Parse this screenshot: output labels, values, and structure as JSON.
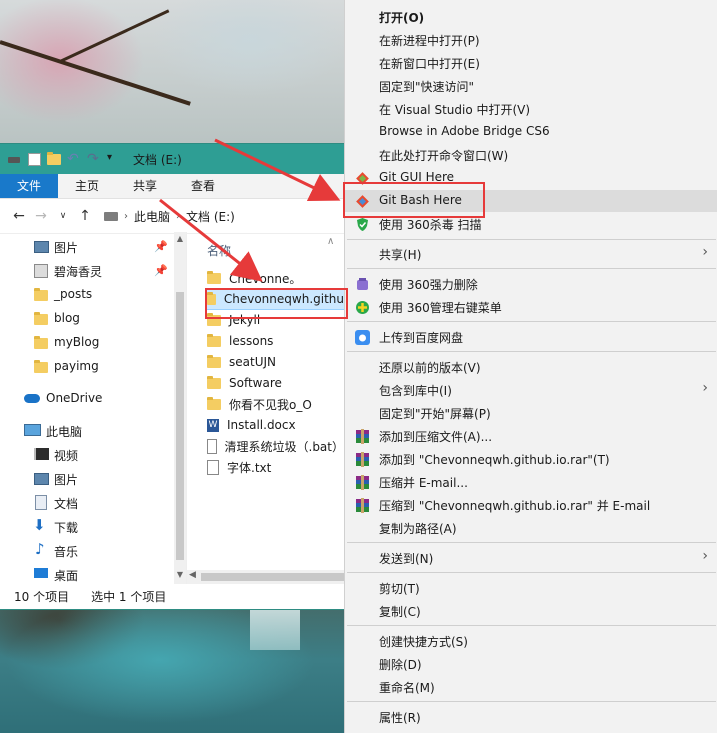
{
  "explorer": {
    "title": "文档 (E:)",
    "ribbon_tabs": [
      "文件",
      "主页",
      "共享",
      "查看"
    ],
    "breadcrumb": [
      "此电脑",
      "文档 (E:)"
    ],
    "column_header": "名称",
    "nav": {
      "quick": [
        {
          "label": "图片",
          "pinned": true
        },
        {
          "label": "碧海香灵",
          "pinned": true
        },
        {
          "label": "_posts",
          "pinned": false
        },
        {
          "label": "blog",
          "pinned": false
        },
        {
          "label": "myBlog",
          "pinned": false
        },
        {
          "label": "payimg",
          "pinned": false
        }
      ],
      "onedrive": "OneDrive",
      "this_pc": "此电脑",
      "pc_items": [
        "视频",
        "图片",
        "文档",
        "下载",
        "音乐",
        "桌面"
      ]
    },
    "files": [
      {
        "name": "Chevonne。",
        "icon": "folder-icon",
        "selected": false
      },
      {
        "name": "Chevonneqwh.githu",
        "icon": "folder-icon",
        "selected": true
      },
      {
        "name": "Jekyll",
        "icon": "folder-icon",
        "selected": false
      },
      {
        "name": "lessons",
        "icon": "folder-icon",
        "selected": false
      },
      {
        "name": "seatUJN",
        "icon": "folder-icon",
        "selected": false
      },
      {
        "name": "Software",
        "icon": "folder-icon",
        "selected": false
      },
      {
        "name": "你看不见我o_O",
        "icon": "folder-icon",
        "selected": false
      },
      {
        "name": "Install.docx",
        "icon": "word-doc-icon",
        "selected": false
      },
      {
        "name": "清理系统垃圾（.bat）",
        "icon": "text-file-icon",
        "selected": false
      },
      {
        "name": "字体.txt",
        "icon": "text-file-icon",
        "selected": false
      }
    ],
    "status": {
      "count": "10 个项目",
      "selected": "选中 1 个项目"
    }
  },
  "menu": {
    "items": [
      {
        "label": "打开(O)",
        "bold": true
      },
      {
        "label": "在新进程中打开(P)"
      },
      {
        "label": "在新窗口中打开(E)"
      },
      {
        "label": "固定到\"快速访问\""
      },
      {
        "label": "在 Visual Studio 中打开(V)"
      },
      {
        "label": "Browse in Adobe Bridge CS6"
      },
      {
        "label": "在此处打开命令窗口(W)"
      },
      {
        "label": "Git GUI Here",
        "icon": "git-icon"
      },
      {
        "label": "Git Bash Here",
        "icon": "git-icon",
        "highlighted": true
      },
      {
        "label": "使用 360杀毒 扫描",
        "icon": "shield-icon"
      },
      {
        "label": "共享(H)",
        "submenu": true
      },
      {
        "label": "使用 360强力删除",
        "icon": "360-delete-icon"
      },
      {
        "label": "使用 360管理右键菜单",
        "icon": "360-manage-icon"
      },
      {
        "label": "上传到百度网盘",
        "icon": "baidu-cloud-icon"
      },
      {
        "label": "还原以前的版本(V)"
      },
      {
        "label": "包含到库中(I)",
        "submenu": true
      },
      {
        "label": "固定到\"开始\"屏幕(P)"
      },
      {
        "label": "添加到压缩文件(A)...",
        "icon": "winrar-icon"
      },
      {
        "label": "添加到 \"Chevonneqwh.github.io.rar\"(T)",
        "icon": "winrar-icon"
      },
      {
        "label": "压缩并 E-mail...",
        "icon": "winrar-icon"
      },
      {
        "label": "压缩到 \"Chevonneqwh.github.io.rar\" 并 E-mail",
        "icon": "winrar-icon"
      },
      {
        "label": "复制为路径(A)"
      },
      {
        "label": "发送到(N)",
        "submenu": true
      },
      {
        "label": "剪切(T)"
      },
      {
        "label": "复制(C)"
      },
      {
        "label": "创建快捷方式(S)"
      },
      {
        "label": "删除(D)"
      },
      {
        "label": "重命名(M)"
      },
      {
        "label": "属性(R)"
      }
    ]
  },
  "colors": {
    "titlebar": "#2e9e94",
    "file_tab": "#1979ca",
    "selection": "#cce8ff",
    "annotation": "#e63a3a",
    "menu_bg": "#f2f2f2"
  }
}
